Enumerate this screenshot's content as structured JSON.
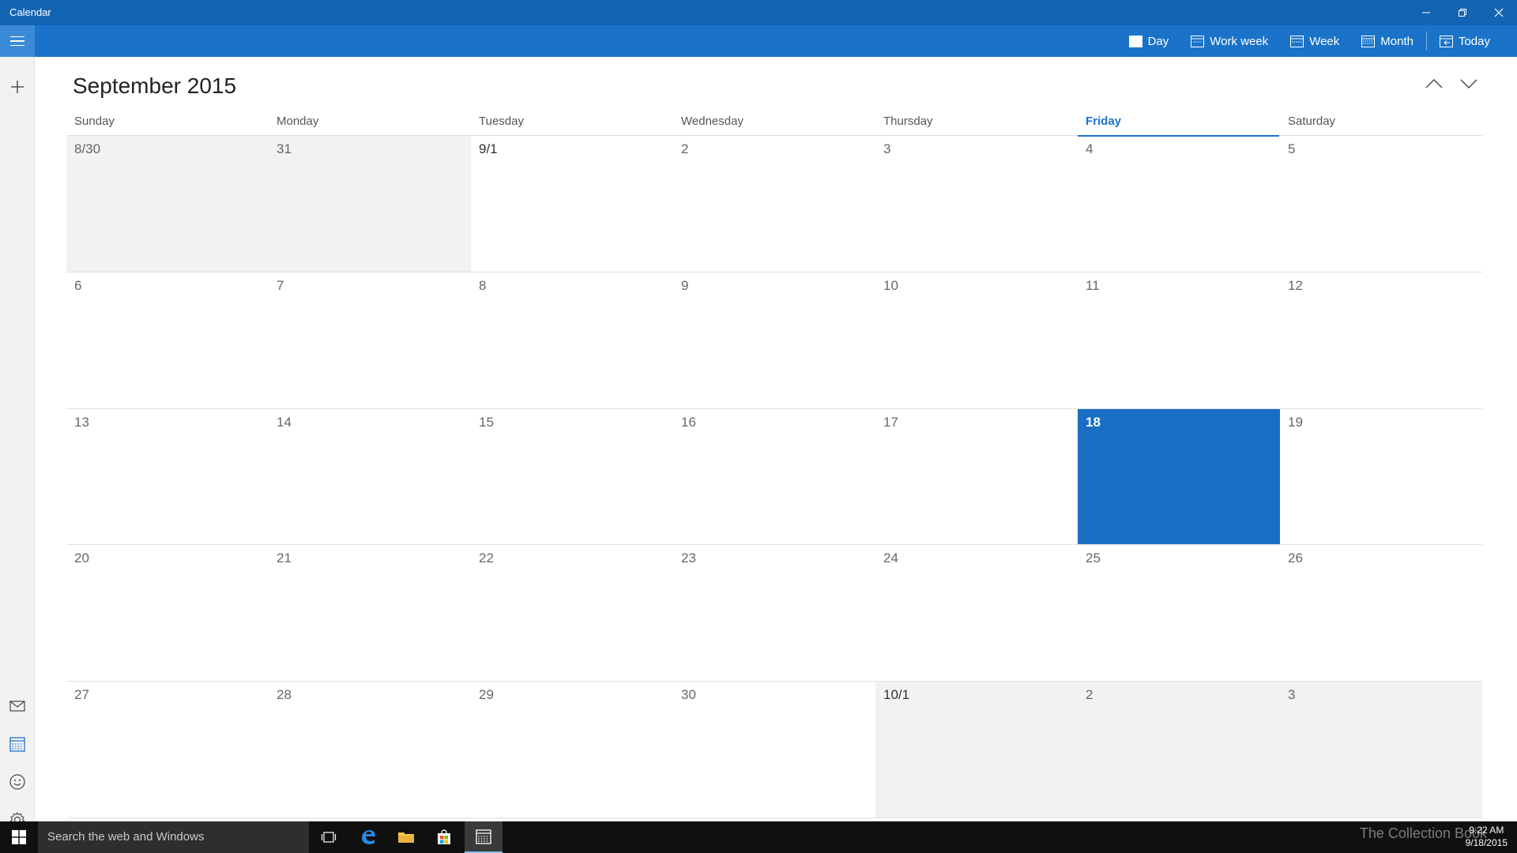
{
  "window": {
    "title": "Calendar",
    "minimize_label": "–",
    "restore_label": "❐",
    "close_label": "✕"
  },
  "toolbar": {
    "views": [
      {
        "label": "Day",
        "icon": "day-icon"
      },
      {
        "label": "Work week",
        "icon": "work-week-icon"
      },
      {
        "label": "Week",
        "icon": "week-icon"
      },
      {
        "label": "Month",
        "icon": "month-icon"
      },
      {
        "label": "Today",
        "icon": "today-icon"
      }
    ]
  },
  "calendar": {
    "month_title": "September 2015",
    "weekdays": [
      "Sunday",
      "Monday",
      "Tuesday",
      "Wednesday",
      "Thursday",
      "Friday",
      "Saturday"
    ],
    "today_weekday_index": 5,
    "weeks": [
      [
        {
          "label": "8/30",
          "other": true
        },
        {
          "label": "31",
          "other": true
        },
        {
          "label": "9/1",
          "first": true
        },
        {
          "label": "2"
        },
        {
          "label": "3"
        },
        {
          "label": "4"
        },
        {
          "label": "5"
        }
      ],
      [
        {
          "label": "6"
        },
        {
          "label": "7"
        },
        {
          "label": "8"
        },
        {
          "label": "9"
        },
        {
          "label": "10"
        },
        {
          "label": "11"
        },
        {
          "label": "12"
        }
      ],
      [
        {
          "label": "13"
        },
        {
          "label": "14"
        },
        {
          "label": "15"
        },
        {
          "label": "16"
        },
        {
          "label": "17"
        },
        {
          "label": "18",
          "today": true
        },
        {
          "label": "19"
        }
      ],
      [
        {
          "label": "20"
        },
        {
          "label": "21"
        },
        {
          "label": "22"
        },
        {
          "label": "23"
        },
        {
          "label": "24"
        },
        {
          "label": "25"
        },
        {
          "label": "26"
        }
      ],
      [
        {
          "label": "27"
        },
        {
          "label": "28"
        },
        {
          "label": "29"
        },
        {
          "label": "30"
        },
        {
          "label": "10/1",
          "other": true,
          "first": true
        },
        {
          "label": "2",
          "other": true
        },
        {
          "label": "3",
          "other": true
        }
      ]
    ]
  },
  "taskbar": {
    "search_placeholder": "Search the web and Windows",
    "clock_time": "9:22 AM",
    "clock_date": "9/18/2015",
    "watermark": "The Collection Book"
  },
  "colors": {
    "titlebar": "#1464b4",
    "accent": "#1a73c9",
    "today_cell": "#1a6fc4",
    "other_month": "#f2f2f2"
  }
}
